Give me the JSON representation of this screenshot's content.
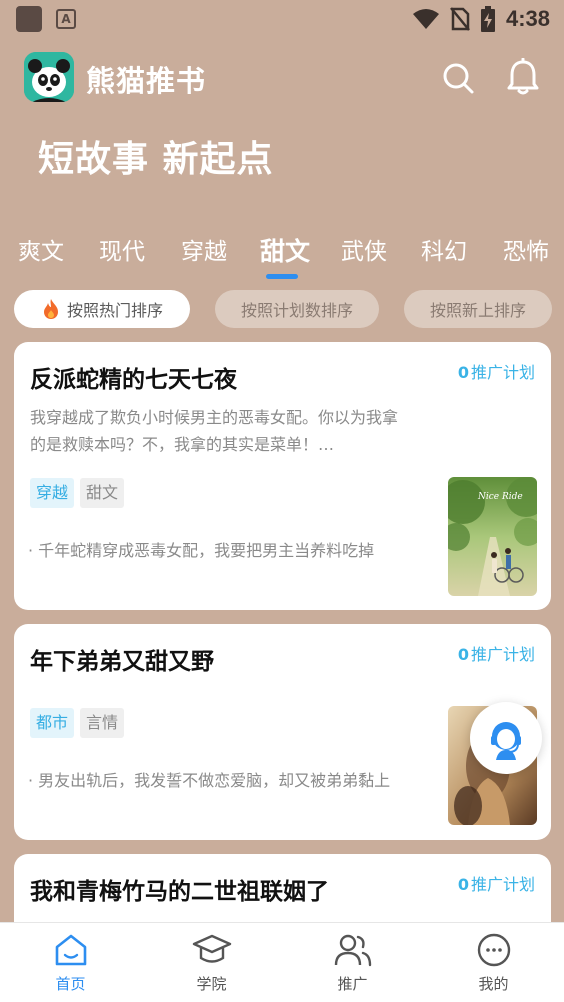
{
  "status_bar": {
    "time": "4:38",
    "app_icon_letter": "A"
  },
  "header": {
    "app_name": "熊猫推书"
  },
  "slogan": "短故事 新起点",
  "categories": [
    {
      "label": "爽文"
    },
    {
      "label": "现代"
    },
    {
      "label": "穿越"
    },
    {
      "label": "甜文",
      "active": true
    },
    {
      "label": "武侠"
    },
    {
      "label": "科幻"
    },
    {
      "label": "恐怖"
    }
  ],
  "sort_options": [
    {
      "label": "按照热门排序",
      "active": true
    },
    {
      "label": "按照计划数排序"
    },
    {
      "label": "按照新上排序"
    }
  ],
  "books": [
    {
      "title": "反派蛇精的七天七夜",
      "promo_count": "0",
      "promo_label": "推广计划",
      "description": "我穿越成了欺负小时候男主的恶毒女配。你以为我拿的是救赎本吗？不，我拿的其实是菜单！…",
      "tags": [
        "穿越",
        "甜文"
      ],
      "summary": "· 千年蛇精穿成恶毒女配，我要把男主当养料吃掉",
      "cover_text": "Nice Ride"
    },
    {
      "title": "年下弟弟又甜又野",
      "promo_count": "0",
      "promo_label": "推广计划",
      "tags": [
        "都市",
        "言情"
      ],
      "summary": "· 男友出轨后，我发誓不做恋爱脑，却又被弟弟黏上"
    },
    {
      "title": "我和青梅竹马的二世祖联姻了",
      "promo_count": "0",
      "promo_label": "推广计划"
    }
  ],
  "bottom_nav": [
    {
      "label": "首页",
      "icon": "home-icon",
      "active": true
    },
    {
      "label": "学院",
      "icon": "graduation-cap-icon"
    },
    {
      "label": "推广",
      "icon": "users-icon"
    },
    {
      "label": "我的",
      "icon": "profile-face-icon"
    }
  ],
  "colors": {
    "background": "#c9ad9b",
    "accent": "#2d8ef0",
    "promo": "#3ab3e6",
    "tag_blue": "#36aee3"
  }
}
